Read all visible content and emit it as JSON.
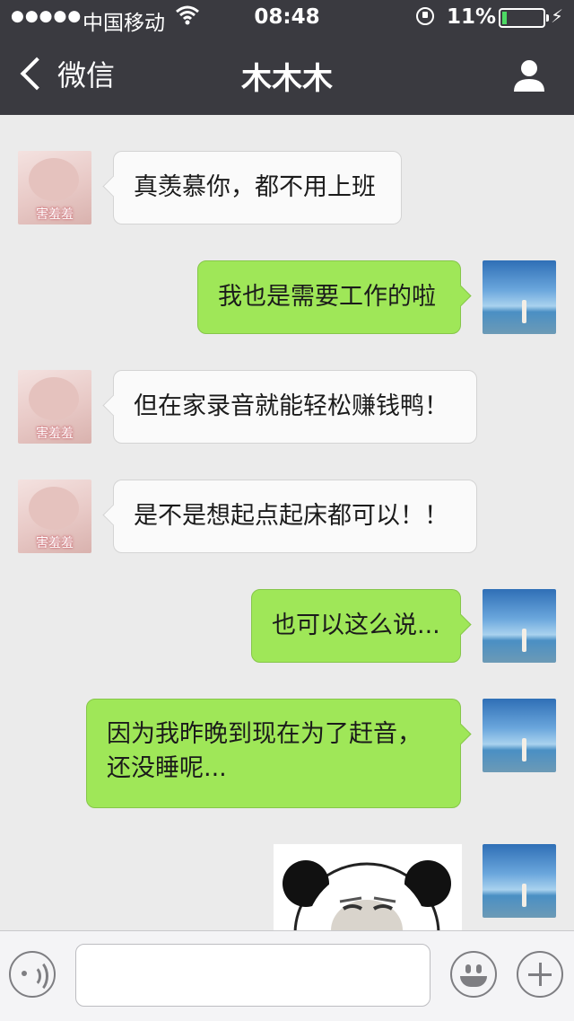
{
  "status_bar": {
    "signal": "●●●●●",
    "carrier": "中国移动",
    "time": "08:48",
    "battery_percent": "11%",
    "battery_level": 0.11
  },
  "nav": {
    "back_label": "微信",
    "title": "木木木"
  },
  "avatars": {
    "contact_caption": "害羞羞"
  },
  "messages": [
    {
      "side": "left",
      "text": "真羡慕你，都不用上班"
    },
    {
      "side": "right",
      "text": "我也是需要工作的啦"
    },
    {
      "side": "left",
      "text": "但在家录音就能轻松赚钱鸭！"
    },
    {
      "side": "left",
      "text": "是不是想起点起床都可以！！"
    },
    {
      "side": "right",
      "text": "也可以这么说..."
    },
    {
      "side": "right",
      "text": "因为我昨晚到现在为了赶音，\n还没睡呢..."
    },
    {
      "side": "right",
      "type": "sticker",
      "description_icon": "panda-face-sticker"
    }
  ],
  "colors": {
    "nav_bg": "#3a3a40",
    "chat_bg": "#ebebeb",
    "bubble_sent": "#9fe758",
    "bubble_received": "#fafafa",
    "battery_fill": "#4cd964"
  },
  "icons": {
    "back": "chevron-left-icon",
    "profile": "person-icon",
    "voice": "voice-icon",
    "emoji": "smiley-icon",
    "more": "plus-icon"
  }
}
